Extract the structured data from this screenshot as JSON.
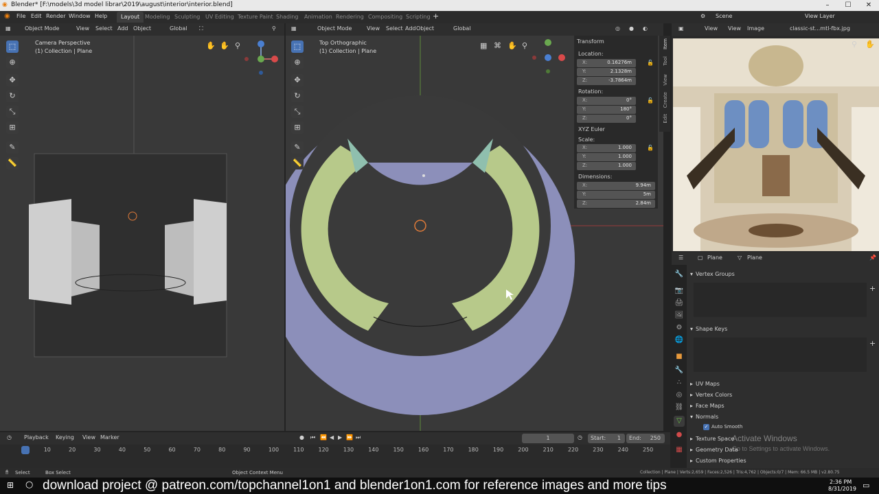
{
  "title": "Blender* [F:\\models\\3d model librar\\2019\\august\\interior\\interior.blend]",
  "menus": [
    "File",
    "Edit",
    "Render",
    "Window",
    "Help"
  ],
  "workspaces": [
    "Layout",
    "Modeling",
    "Sculpting",
    "UV Editing",
    "Texture Paint",
    "Shading",
    "Animation",
    "Rendering",
    "Compositing",
    "Scripting"
  ],
  "scene": "Scene",
  "view_layer": "View Layer",
  "left_view": {
    "mode": "Object Mode",
    "menus": [
      "View",
      "Select",
      "Add",
      "Object"
    ],
    "orientation": "Global",
    "label": "Camera Perspective",
    "collection": "(1) Collection | Plane"
  },
  "mid_view": {
    "mode": "Object Mode",
    "menus": [
      "View",
      "Select",
      "Add",
      "Object"
    ],
    "orientation": "Global",
    "label": "Top Orthographic",
    "collection": "(1) Collection | Plane"
  },
  "transform": {
    "title": "Transform",
    "location_label": "Location:",
    "location": {
      "x": "0.16276m",
      "y": "2.1328m",
      "z": "-3.7864m"
    },
    "rotation_label": "Rotation:",
    "rotation": {
      "x": "0°",
      "y": "180°",
      "z": "0°"
    },
    "rotation_mode": "XYZ Euler",
    "scale_label": "Scale:",
    "scale": {
      "x": "1.000",
      "y": "1.000",
      "z": "1.000"
    },
    "dimensions_label": "Dimensions:",
    "dimensions": {
      "x": "9.94m",
      "y": "5m",
      "z": "2.84m"
    }
  },
  "npanel_tabs": [
    "Item",
    "Tool",
    "View",
    "Create",
    "Edit"
  ],
  "image_editor": {
    "menus": [
      "View",
      "View",
      "Image"
    ],
    "image_name": "classic-st...mtl-fbx.jpg"
  },
  "properties": {
    "breadcrumb_object": "Plane",
    "breadcrumb_data": "Plane",
    "vertex_groups": "Vertex Groups",
    "shape_keys": "Shape Keys",
    "uv_maps": "UV Maps",
    "vertex_colors": "Vertex Colors",
    "face_maps": "Face Maps",
    "normals": "Normals",
    "auto_smooth": "Auto Smooth",
    "texture_space": "Texture Space",
    "geometry_data": "Geometry Data",
    "custom_properties": "Custom Properties"
  },
  "watermark": {
    "line1": "Activate Windows",
    "line2": "Go to Settings to activate Windows."
  },
  "timeline": {
    "menus": [
      "Playback",
      "Keying",
      "View",
      "Marker"
    ],
    "current_frame": "1",
    "start_label": "Start:",
    "start": "1",
    "end_label": "End:",
    "end": "250",
    "ticks": [
      "1",
      "10",
      "20",
      "30",
      "40",
      "50",
      "60",
      "70",
      "80",
      "90",
      "100",
      "110",
      "120",
      "130",
      "140",
      "150",
      "160",
      "170",
      "180",
      "190",
      "200",
      "210",
      "220",
      "230",
      "240",
      "250"
    ]
  },
  "status": {
    "select": "Select",
    "box_select": "Box Select",
    "context_menu": "Object Context Menu",
    "stats": "Collection | Plane | Verts:2,659 | Faces:2,526 | Tris:4,762 | Objects:0/7 | Mem: 66.5 MB | v2.80.75"
  },
  "banner": "download project @ patreon.com/topchannel1on1  and blender1on1.com for reference images and more tips",
  "clock": {
    "time": "2:36 PM",
    "date": "8/31/2019"
  },
  "colors": {
    "accent": "#4772b3",
    "viewport": "#393939",
    "plane": "#8c8fba",
    "stairs": "#b7c98a"
  }
}
